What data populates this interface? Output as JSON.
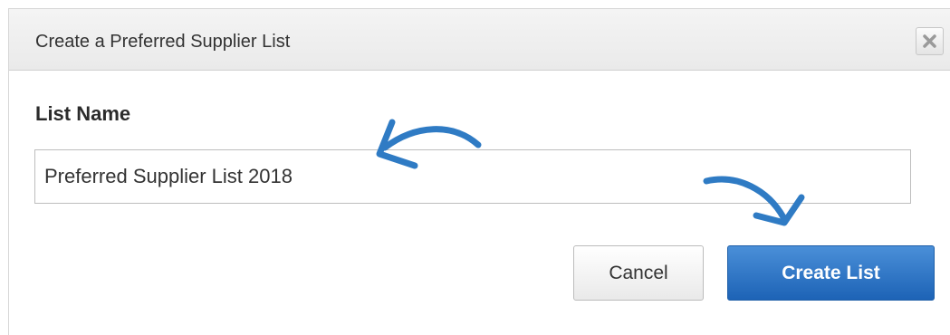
{
  "dialog": {
    "title": "Create a Preferred Supplier List",
    "close_icon": "close-icon"
  },
  "form": {
    "label": "List Name",
    "value": "Preferred Supplier List 2018"
  },
  "buttons": {
    "cancel": "Cancel",
    "create": "Create List"
  },
  "annotations": {
    "color": "#2f7bc4"
  }
}
